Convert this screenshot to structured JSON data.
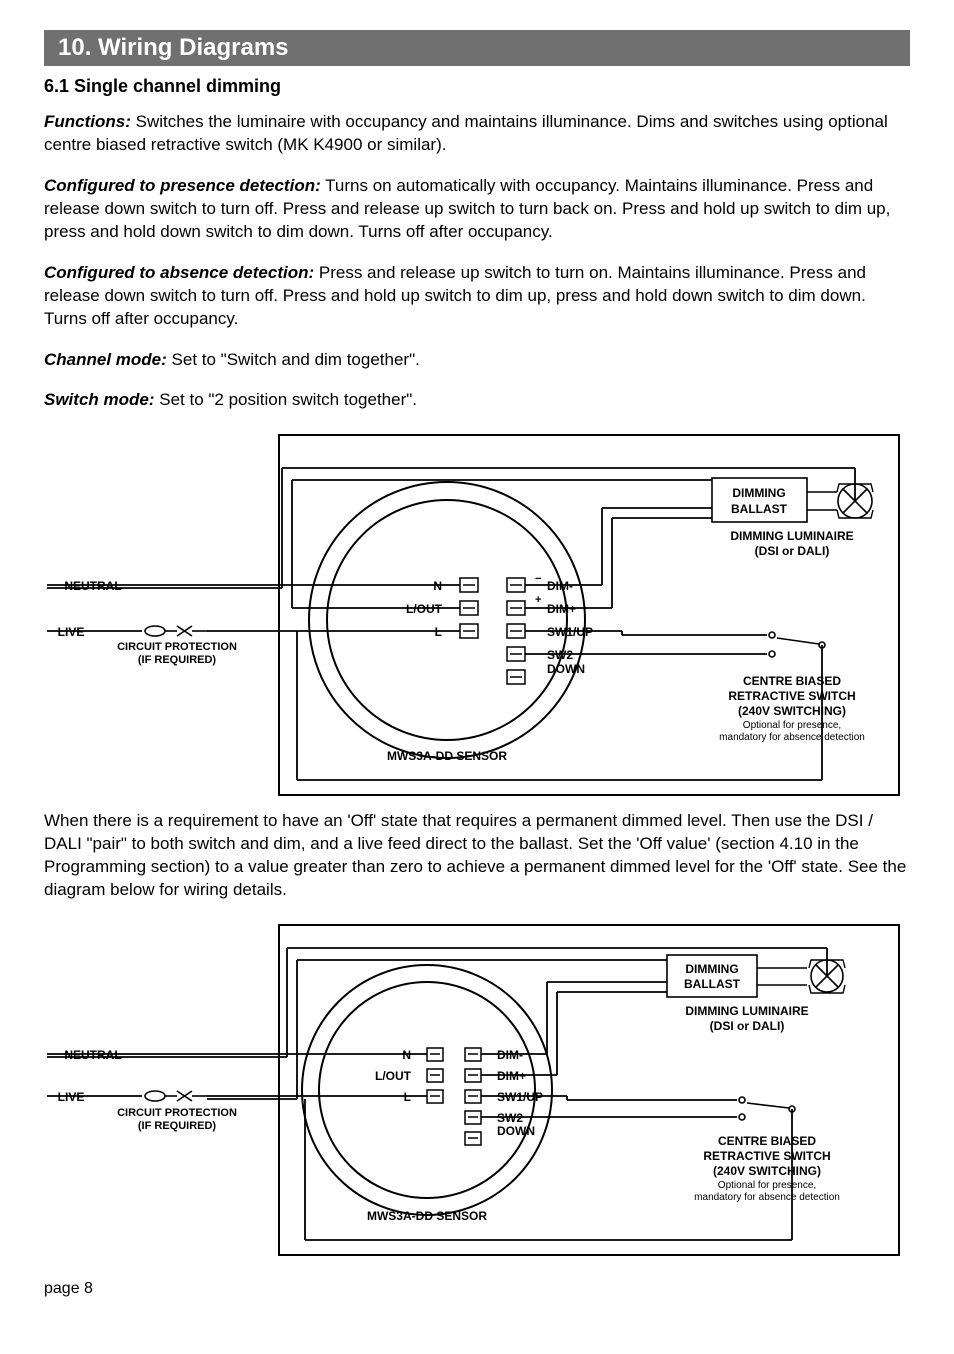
{
  "section": {
    "bar": "10.  Wiring Diagrams",
    "subhead": "6.1 Single channel dimming"
  },
  "paragraphs": {
    "functions_lead": "Functions:",
    "functions_body": " Switches the luminaire with occupancy and maintains illuminance. Dims and switches using optional centre biased retractive switch (MK K4900 or similar).",
    "presence_lead": "Configured to presence detection:",
    "presence_body": "  Turns on automatically with occupancy. Maintains illuminance. Press and release down switch to turn off. Press and release up switch to turn back on. Press and hold up switch to dim up, press and hold down switch to dim down. Turns off after occupancy.",
    "absence_lead": "Configured to absence detection:",
    "absence_body": "  Press and release up switch to turn on. Maintains illuminance. Press and release down switch to turn off. Press and hold up switch to dim up, press and hold down switch to dim down. Turns off after occupancy.",
    "channel_lead": "Channel mode:",
    "channel_body": " Set to \"Switch and dim together\".",
    "switchmode_lead": "Switch mode:",
    "switchmode_body": " Set to \"2 position switch together\".",
    "middle": "When there is a requirement to have an 'Off' state that requires a permanent dimmed level. Then use the DSI / DALI \"pair\" to both switch and dim, and a live feed direct to the ballast. Set the 'Off value' (section 4.10 in the Programming section) to a value greater than zero to achieve a permanent dimmed level for the 'Off' state. See the diagram below for wiring details."
  },
  "diagram": {
    "neutral": "NEUTRAL",
    "live": "LIVE",
    "circ1": "CIRCUIT PROTECTION",
    "circ2": "(IF REQUIRED)",
    "n": "N",
    "lout": "L/OUT",
    "l": "L",
    "dimm": "DIM-",
    "dimp": "DIM+",
    "sw1": "SW1/UP",
    "sw2a": "SW2",
    "sw2b": "DOWN",
    "sensor": "MWS3A-DD SENSOR",
    "ballast1": "DIMMING",
    "ballast2": "BALLAST",
    "lumin1": "DIMMING LUMINAIRE",
    "lumin2": "(DSI or DALI)",
    "retr1": "CENTRE BIASED",
    "retr2": "RETRACTIVE SWITCH",
    "retr3": "(240V SWITCHING)",
    "retr4": "Optional for presence,",
    "retr5": "mandatory for absence detection"
  },
  "footer": {
    "pagenum": "page 8"
  }
}
